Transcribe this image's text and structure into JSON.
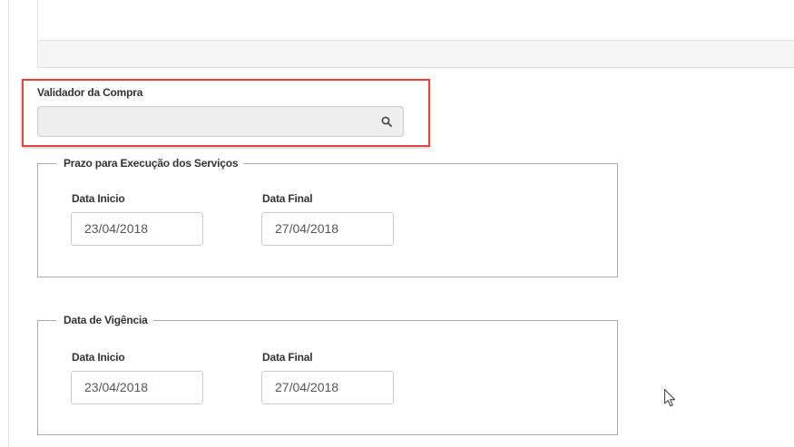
{
  "validador": {
    "label": "Validador da Compra",
    "value": "",
    "search_icon": "search-icon"
  },
  "prazo_execucao": {
    "legend": "Prazo para Execução dos Serviços",
    "data_inicio_label": "Data Inicio",
    "data_inicio_value": "23/04/2018",
    "data_final_label": "Data Final",
    "data_final_value": "27/04/2018"
  },
  "vigencia": {
    "legend": "Data de Vigência",
    "data_inicio_label": "Data Inicio",
    "data_inicio_value": "23/04/2018",
    "data_final_label": "Data Final",
    "data_final_value": "27/04/2018"
  },
  "colors": {
    "highlight": "#e0453f",
    "readonly_input_bg": "#eeeeee",
    "fieldset_border": "#aaaaaa"
  }
}
